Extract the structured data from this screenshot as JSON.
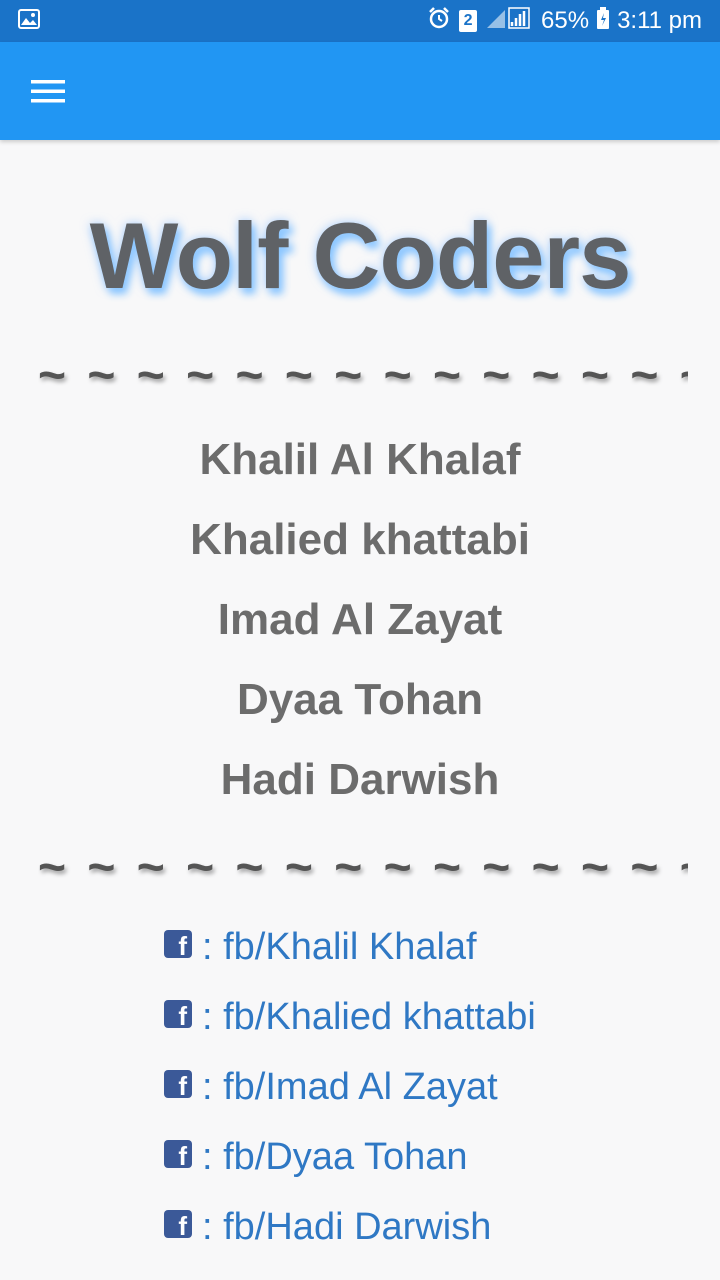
{
  "status_bar": {
    "icons": [
      "gallery-icon",
      "alarm-icon",
      "sim2-icon",
      "signal-icon",
      "battery-icon"
    ],
    "sim_badge": "2",
    "battery": "65%",
    "time": "3:11 pm"
  },
  "app_bar": {
    "menu_icon": "hamburger-menu-icon",
    "color": "#2196f3"
  },
  "title": "Wolf Coders",
  "divider": "~ ~ ~ ~ ~ ~ ~ ~ ~ ~ ~ ~ ~ ~ ~ ~",
  "team": [
    {
      "name": "Khalil Al Khalaf"
    },
    {
      "name": "Khalied khattabi"
    },
    {
      "name": "Imad Al Zayat"
    },
    {
      "name": "Dyaa Tohan"
    },
    {
      "name": "Hadi Darwish"
    }
  ],
  "links": [
    {
      "icon": "facebook-icon",
      "text": ": fb/Khalil Khalaf"
    },
    {
      "icon": "facebook-icon",
      "text": ": fb/Khalied khattabi"
    },
    {
      "icon": "facebook-icon",
      "text": ": fb/Imad Al Zayat"
    },
    {
      "icon": "facebook-icon",
      "text": ": fb/Dyaa Tohan"
    },
    {
      "icon": "facebook-icon",
      "text": ": fb/Hadi Darwish"
    }
  ],
  "colors": {
    "status_bar": "#1a73c8",
    "link": "#2f78c4",
    "facebook": "#3b5998"
  }
}
